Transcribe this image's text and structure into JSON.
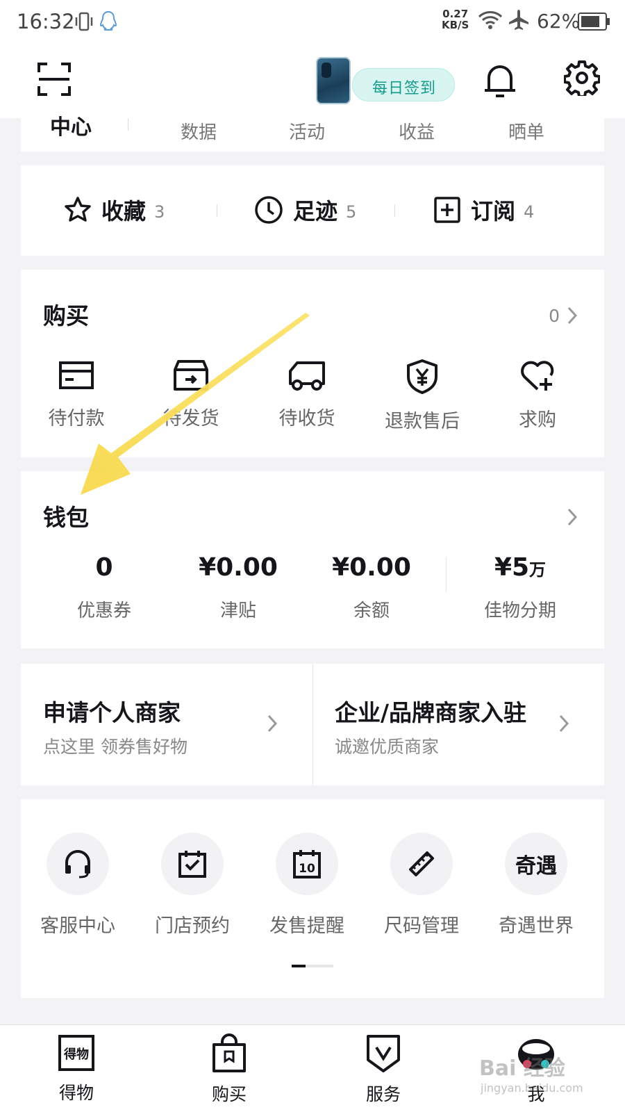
{
  "status_bar": {
    "time": "16:32",
    "net_speed_value": "0.27",
    "net_speed_unit": "KB/S",
    "battery": "62%"
  },
  "header": {
    "checkin_label": "每日签到"
  },
  "top_strip": {
    "items": [
      "中心",
      "数据",
      "活动",
      "收益",
      "晒单"
    ]
  },
  "fav_bar": {
    "items": [
      {
        "label": "收藏",
        "count": "3"
      },
      {
        "label": "足迹",
        "count": "5"
      },
      {
        "label": "订阅",
        "count": "4"
      }
    ]
  },
  "buy": {
    "title": "购买",
    "count": "0",
    "items": [
      {
        "label": "待付款",
        "icon": "card-icon"
      },
      {
        "label": "待发货",
        "icon": "box-icon"
      },
      {
        "label": "待收货",
        "icon": "truck-icon"
      },
      {
        "label": "退款售后",
        "icon": "shield-yen-icon"
      },
      {
        "label": "求购",
        "icon": "heart-plus-icon"
      }
    ]
  },
  "wallet": {
    "title": "钱包",
    "items": [
      {
        "value": "0",
        "label": "优惠券"
      },
      {
        "value": "¥0.00",
        "label": "津贴"
      },
      {
        "value": "¥0.00",
        "label": "余额"
      },
      {
        "value": "¥5",
        "unit": "万",
        "label": "佳物分期"
      }
    ]
  },
  "merchant": {
    "personal": {
      "title": "申请个人商家",
      "subtitle": "点这里 领券售好物"
    },
    "brand": {
      "title": "企业/品牌商家入驻",
      "subtitle": "诚邀优质商家"
    }
  },
  "tools": {
    "items": [
      {
        "label": "客服中心",
        "icon": "headset-icon"
      },
      {
        "label": "门店预约",
        "icon": "calendar-check-icon"
      },
      {
        "label": "发售提醒",
        "icon": "calendar-10-icon",
        "icon_text": "10"
      },
      {
        "label": "尺码管理",
        "icon": "ruler-icon"
      },
      {
        "label": "奇遇世界",
        "icon": "qiyu-icon",
        "icon_text": "奇遇"
      }
    ],
    "page_index": 1,
    "page_count": 3
  },
  "tabbar": {
    "items": [
      {
        "label": "得物",
        "icon_text": "得物"
      },
      {
        "label": "购买"
      },
      {
        "label": "服务"
      },
      {
        "label": "我"
      }
    ]
  },
  "watermark": {
    "brand": "Bai 经验",
    "site": "jingyan.baidu.com"
  },
  "colors": {
    "accent_teal": "#159a8c",
    "arrow_yellow": "#f7d94c",
    "text_primary": "#16161a",
    "text_secondary": "#666666"
  }
}
